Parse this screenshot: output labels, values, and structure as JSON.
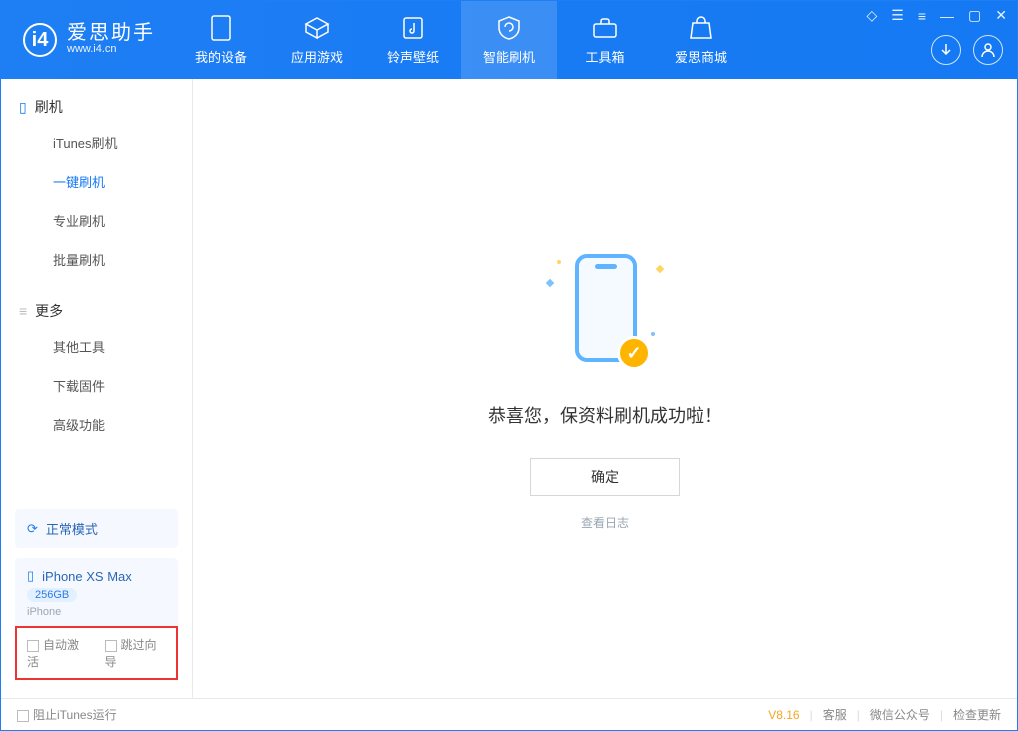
{
  "app": {
    "name_cn": "爱思助手",
    "url": "www.i4.cn"
  },
  "tabs": [
    {
      "label": "我的设备"
    },
    {
      "label": "应用游戏"
    },
    {
      "label": "铃声壁纸"
    },
    {
      "label": "智能刷机"
    },
    {
      "label": "工具箱"
    },
    {
      "label": "爱思商城"
    }
  ],
  "sidebar": {
    "section1": {
      "title": "刷机",
      "items": [
        "iTunes刷机",
        "一键刷机",
        "专业刷机",
        "批量刷机"
      ]
    },
    "section2": {
      "title": "更多",
      "items": [
        "其他工具",
        "下载固件",
        "高级功能"
      ]
    },
    "mode_card": {
      "label": "正常模式"
    },
    "device_card": {
      "name": "iPhone XS Max",
      "storage": "256GB",
      "type": "iPhone"
    },
    "checks": {
      "auto_activate": "自动激活",
      "skip_guide": "跳过向导"
    }
  },
  "main": {
    "message": "恭喜您，保资料刷机成功啦！",
    "ok": "确定",
    "view_log": "查看日志"
  },
  "footer": {
    "block_itunes": "阻止iTunes运行",
    "version": "V8.16",
    "links": [
      "客服",
      "微信公众号",
      "检查更新"
    ]
  }
}
